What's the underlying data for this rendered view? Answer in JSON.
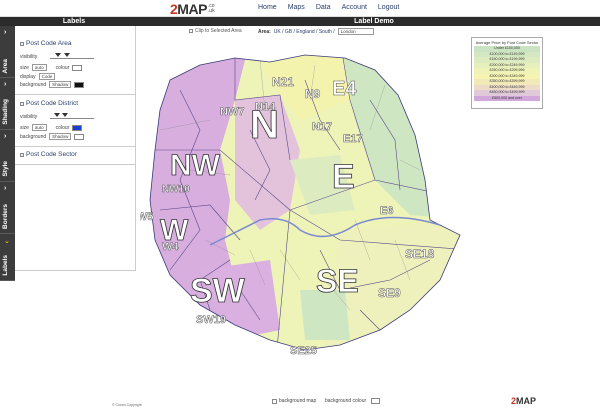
{
  "brand": {
    "logo_prefix": "2",
    "logo_word": "MAP",
    "logo_tld_top": ".co",
    "logo_tld_bottom": ".uk"
  },
  "nav": [
    "Home",
    "Maps",
    "Data",
    "Account",
    "Logout"
  ],
  "headers": {
    "left": "Labels",
    "right": "Label Demo"
  },
  "tabs": [
    "Area",
    "Shading",
    "Style",
    "Borders",
    "Labels"
  ],
  "sections": {
    "area": {
      "title": "Post Code Area",
      "visibility_label": "visibility",
      "size_label": "size",
      "size_value": "auto",
      "colour_label": "colour",
      "display_label": "display",
      "display_value": "Code",
      "background_label": "background",
      "background_value": "Shadow"
    },
    "district": {
      "title": "Post Code District",
      "visibility_label": "visibility",
      "size_label": "size",
      "size_value": "auto",
      "colour_label": "colour",
      "background_label": "background",
      "background_value": "Shadow"
    },
    "sector": {
      "title": "Post Code Sector"
    }
  },
  "colors": {
    "area_colour": "#ffffff",
    "area_background": "#111111",
    "district_colour": "#1a3fd1",
    "district_background": "#ffffff",
    "tab_active": "#f1c40f"
  },
  "map_controls": {
    "clip_label": "Clip to Selected Area",
    "area_key": "Area:",
    "area_path": "UK / GB / England / South /",
    "area_select": "London"
  },
  "map_labels": {
    "areas": [
      "N",
      "NW",
      "W",
      "SW",
      "SE",
      "E"
    ],
    "districts": [
      "N21",
      "N9",
      "E4",
      "N14",
      "NW7",
      "N17",
      "E17",
      "NW10",
      "E6",
      "W5",
      "W4",
      "SE18",
      "SE9",
      "SW19",
      "SE25"
    ]
  },
  "legend": {
    "title": "Average Price by Post Code Sector",
    "rows": [
      {
        "label": "Under £100,000",
        "color": "#c9e3c3"
      },
      {
        "label": "£100,000  to  £149,999",
        "color": "#d3e8c2"
      },
      {
        "label": "£150,000  to  £199,999",
        "color": "#dcecc0"
      },
      {
        "label": "£200,000  to  £249,999",
        "color": "#e6f0bd"
      },
      {
        "label": "£250,000  to  £299,999",
        "color": "#eff3b8"
      },
      {
        "label": "£300,000  to  £349,999",
        "color": "#f6f4b0"
      },
      {
        "label": "£350,000  to  £399,999",
        "color": "#f2e9b8"
      },
      {
        "label": "£400,000  to  £449,999",
        "color": "#ebdbc7"
      },
      {
        "label": "£450,000  to  £499,999",
        "color": "#e0c9d8"
      },
      {
        "label": "£500,000 and over",
        "color": "#d2a8db"
      }
    ]
  },
  "footer": {
    "background_map_label": "background map",
    "background_colour_label": "background colour",
    "copyright": "© Crown Copyright"
  }
}
